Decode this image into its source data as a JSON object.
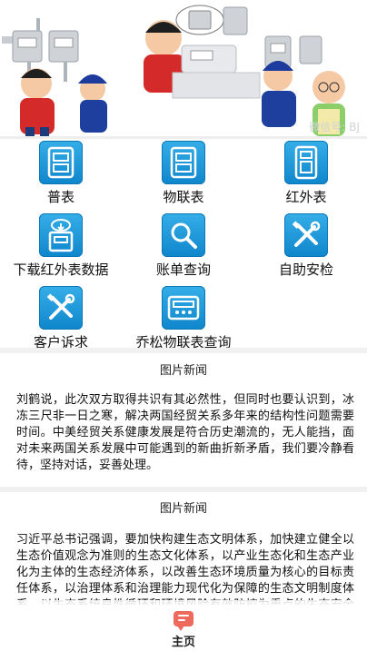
{
  "banner": {
    "watermark": "微信号: BJ"
  },
  "grid": {
    "items": [
      {
        "label": "普表",
        "icon": "meter-icon"
      },
      {
        "label": "物联表",
        "icon": "iot-meter-icon"
      },
      {
        "label": "红外表",
        "icon": "infrared-meter-icon"
      },
      {
        "label": "下载红外表数据",
        "icon": "download-meter-data-icon"
      },
      {
        "label": "账单查询",
        "icon": "search-icon"
      },
      {
        "label": "自助安检",
        "icon": "tools-icon"
      },
      {
        "label": "客户诉求",
        "icon": "tools-icon"
      },
      {
        "label": "乔松物联表查询",
        "icon": "meter-panel-icon"
      }
    ]
  },
  "news": [
    {
      "title": "图片新闻",
      "body": "刘鹤说，此次双方取得共识有其必然性，但同时也要认识到，冰冻三尺非一日之寒，解决两国经贸关系多年来的结构性问题需要时间。中美经贸关系健康发展是符合历史潮流的，无人能挡，面对未来两国关系发展中可能遇到的新曲折新矛盾，我们要冷静看待，坚持对话，妥善处理。"
    },
    {
      "title": "图片新闻",
      "body": "习近平总书记强调，要加快构建生态文明体系，加快建立健全以生态价值观念为准则的生态文化体系，以产业生态化和生态产业化为主体的生态经济体系，以改善生态环境质量为核心的目标责任体系，以治理体系和治理能力现代化为保障的生态文明制度体系，以生态系统良性循环和环境风险有效防控为重点的生态安全体系。"
    }
  ],
  "bottom_nav": {
    "home_label": "主页",
    "home_icon": "chat-bubble-icon"
  },
  "colors": {
    "tile_blue": "#1a95d8",
    "nav_red": "#ee6a5c"
  }
}
